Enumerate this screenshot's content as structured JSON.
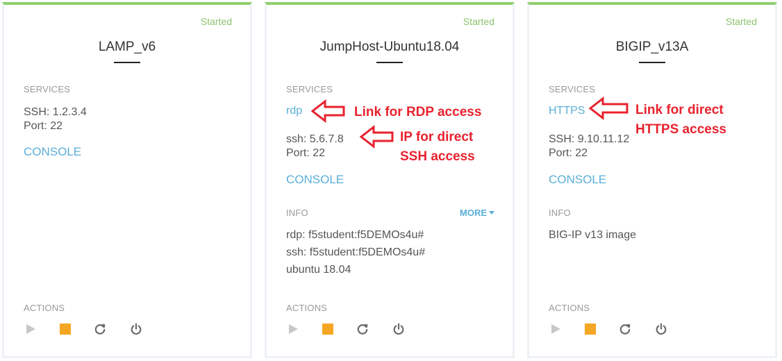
{
  "cards": [
    {
      "status": "Started",
      "title": "LAMP_v6",
      "services_header": "SERVICES",
      "ssh_line": "SSH: 1.2.3.4",
      "port_line": "Port: 22",
      "console_label": "CONSOLE",
      "actions_header": "ACTIONS"
    },
    {
      "status": "Started",
      "title": "JumpHost-Ubuntu18.04",
      "services_header": "SERVICES",
      "rdp_link": "rdp",
      "ssh_line": "ssh: 5.6.7.8",
      "port_line": "Port: 22",
      "console_label": "CONSOLE",
      "info_header": "INFO",
      "more_label": "MORE",
      "info_lines": [
        "rdp: f5student:f5DEMOs4u#",
        "ssh: f5student:f5DEMOs4u#",
        "ubuntu 18.04"
      ],
      "actions_header": "ACTIONS"
    },
    {
      "status": "Started",
      "title": "BIGIP_v13A",
      "services_header": "SERVICES",
      "https_link": "HTTPS",
      "ssh_line": "SSH: 9.10.11.12",
      "port_line": "Port: 22",
      "console_label": "CONSOLE",
      "info_header": "INFO",
      "info_lines": [
        "BIG-IP v13 image"
      ],
      "actions_header": "ACTIONS"
    }
  ],
  "action_icons": [
    "play-icon",
    "stop-icon",
    "restart-icon",
    "power-icon"
  ],
  "annotations": {
    "rdp_note": "Link for RDP access",
    "ssh_note_line1": "IP for direct",
    "ssh_note_line2": "SSH access",
    "https_note_line1": "Link for direct",
    "https_note_line2": "HTTPS access"
  },
  "colors": {
    "status_green": "#8cc46c",
    "top_border_green": "#8fcf6e",
    "link_blue": "#5aaed8",
    "annotation_red": "#e8222e",
    "stop_orange": "#f5a623",
    "disabled_gray": "#c8c8c8",
    "icon_gray": "#6b6b6b"
  }
}
